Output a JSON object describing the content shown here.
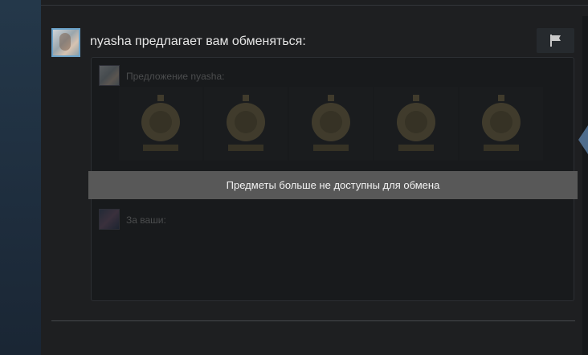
{
  "offer": {
    "title": "nyasha предлагает вам обменяться:",
    "their_label": "Предложение nyasha:",
    "yours_label": "За ваши:",
    "unavailable_banner": "Предметы больше не доступны для обмена",
    "item_count": 5
  },
  "icons": {
    "flag": "flag-icon",
    "item": "rune-item-icon"
  },
  "colors": {
    "panel": "#1e1f21",
    "banner": "#585858",
    "avatar_border": "#6aa1c8",
    "accent_arrow": "#4e6c8c"
  }
}
